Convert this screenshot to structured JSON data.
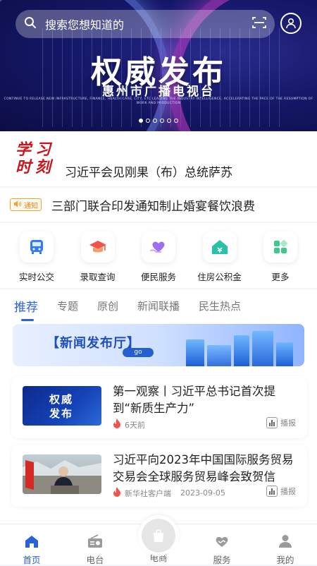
{
  "search": {
    "placeholder": "搜索您想知道的"
  },
  "banner": {
    "title": "权威发布",
    "subtitle": "惠州市广播电视台",
    "small_text": "CONTINUE TO RELEASE NEW INFRASTRUCTURE, FINANCE, HEALTH CARE, CITY, ETC LEADING THE INDUSTRY INTELLIGENCE, ACCELERATING THE PACE OF THE RESUMPTION OF WORK AND PRODUCTION",
    "slide_count": 6,
    "active_slide": 1
  },
  "headline": {
    "column_logo": "学习时刻",
    "text": "习近平会见刚果（布）总统萨苏"
  },
  "notice": {
    "badge": "通知",
    "text": "三部门联合印发通知制止婚宴餐饮浪费"
  },
  "services": [
    {
      "label": "实时公交",
      "icon": "bus-icon",
      "color": "#2f7cf6"
    },
    {
      "label": "录取查询",
      "icon": "graduation-cap-icon",
      "color": "#f2534a"
    },
    {
      "label": "便民服务",
      "icon": "heart-hands-icon",
      "color": "#a06cf2"
    },
    {
      "label": "住房公积金",
      "icon": "house-icon",
      "color": "#29c2a6"
    },
    {
      "label": "更多",
      "icon": "grid-icon",
      "color": "#3cc98d"
    }
  ],
  "tabs": [
    {
      "label": "推荐",
      "active": true
    },
    {
      "label": "专题"
    },
    {
      "label": "原创"
    },
    {
      "label": "新闻联播"
    },
    {
      "label": "民生热点"
    }
  ],
  "promo": {
    "title": "【新闻发布厅】",
    "go": "go"
  },
  "news": [
    {
      "title": "第一观察丨习近平总书记首次提到“新质生产力”",
      "thumb_text": [
        "权威",
        "发布"
      ],
      "source": "",
      "time": "6天前",
      "play_label": "播报"
    },
    {
      "title": "习近平向2023年中国国际服务贸易交易会全球服务贸易峰会致贺信",
      "source": "新华社客户端",
      "time": "2023-09-05",
      "play_label": "播报"
    }
  ],
  "bottom_nav": [
    {
      "label": "首页",
      "icon": "home-icon",
      "active": true
    },
    {
      "label": "电台",
      "icon": "radio-icon"
    },
    {
      "label": "电商",
      "icon": "shopping-bag-icon"
    },
    {
      "label": "服务",
      "icon": "handshake-icon"
    },
    {
      "label": "我的",
      "icon": "person-icon"
    }
  ],
  "colors": {
    "accent": "#2b61d6",
    "headline_red": "#c8161d",
    "notice_orange": "#e2861c"
  }
}
